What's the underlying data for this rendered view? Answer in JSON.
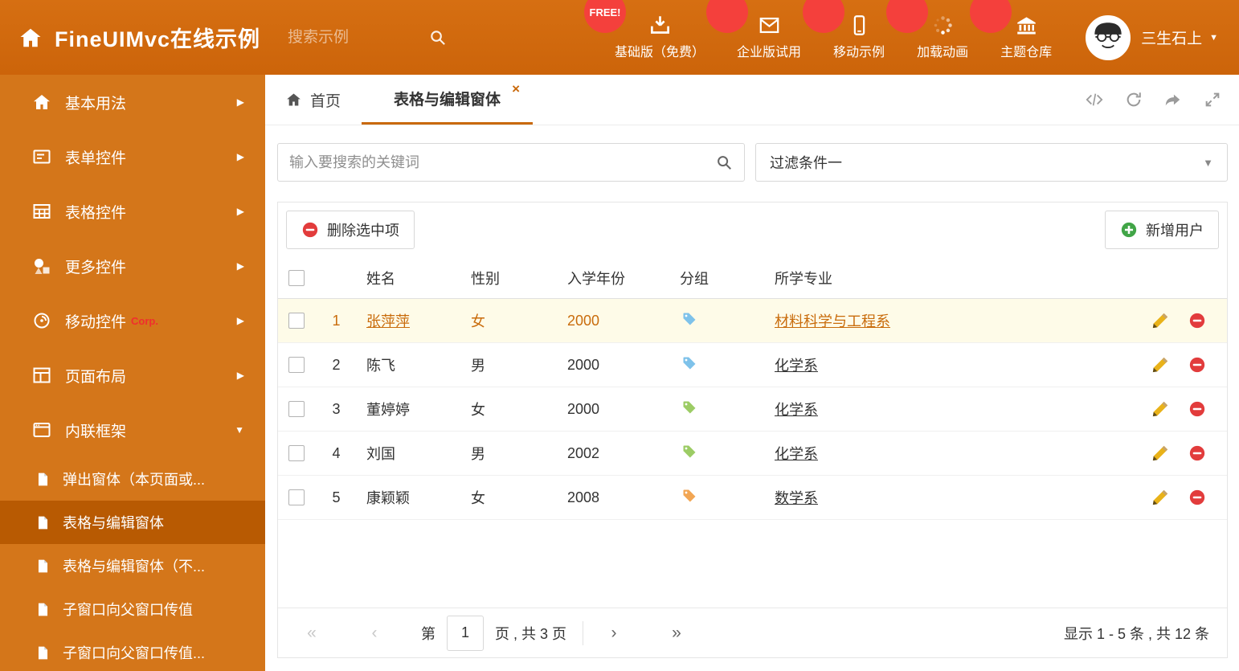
{
  "colors": {
    "accent": "#c9690b",
    "header_bg": "#cc640a",
    "sidebar_bg": "#d4761a",
    "sidebar_active_bg": "#b85a02",
    "selected_row_bg": "#fefbe8",
    "tag_blue": "#7ec2ea",
    "tag_green": "#9ccc65",
    "tag_orange": "#f2a654"
  },
  "icons": {
    "close": "×",
    "caret_down": "▼",
    "arrow_right": "▶",
    "arrow_down": "▼"
  },
  "header": {
    "title": "FineUIMvc在线示例",
    "search_placeholder": "搜索示例",
    "nav": [
      {
        "label": "基础版（免费）",
        "icon": "download-icon",
        "badge": "FREE!"
      },
      {
        "label": "企业版试用",
        "icon": "envelope-icon"
      },
      {
        "label": "移动示例",
        "icon": "mobile-icon"
      },
      {
        "label": "加载动画",
        "icon": "spinner-icon"
      },
      {
        "label": "主题仓库",
        "icon": "bank-icon"
      }
    ],
    "username": "三生石上"
  },
  "sidebar": {
    "items": [
      {
        "label": "基本用法",
        "icon": "home-icon",
        "state": "collapsed"
      },
      {
        "label": "表单控件",
        "icon": "form-icon",
        "state": "collapsed"
      },
      {
        "label": "表格控件",
        "icon": "table-icon",
        "state": "collapsed"
      },
      {
        "label": "更多控件",
        "icon": "controls-icon",
        "state": "collapsed"
      },
      {
        "label": "移动控件",
        "icon": "mobile-nav-icon",
        "badge": "Corp.",
        "state": "collapsed"
      },
      {
        "label": "页面布局",
        "icon": "layout-icon",
        "state": "collapsed"
      },
      {
        "label": "内联框架",
        "icon": "frame-icon",
        "state": "expanded"
      }
    ],
    "subitems": [
      {
        "label": "弹出窗体（本页面或...",
        "active": false
      },
      {
        "label": "表格与编辑窗体",
        "active": true
      },
      {
        "label": "表格与编辑窗体（不...",
        "active": false
      },
      {
        "label": "子窗口向父窗口传值",
        "active": false
      },
      {
        "label": "子窗口向父窗口传值...",
        "active": false
      }
    ]
  },
  "tabs": {
    "items": [
      {
        "label": "首页",
        "active": false
      },
      {
        "label": "表格与编辑窗体",
        "active": true
      }
    ]
  },
  "filter": {
    "keyword_placeholder": "输入要搜索的关键词",
    "condition_value": "过滤条件一"
  },
  "toolbar": {
    "delete_selected": "删除选中项",
    "add_user": "新增用户"
  },
  "table": {
    "columns": [
      "姓名",
      "性别",
      "入学年份",
      "分组",
      "所学专业"
    ],
    "rows": [
      {
        "index": "1",
        "name": "张萍萍",
        "gender": "女",
        "year": "2000",
        "tag": "blue",
        "major": "材料科学与工程系",
        "selected": true
      },
      {
        "index": "2",
        "name": "陈飞",
        "gender": "男",
        "year": "2000",
        "tag": "blue",
        "major": "化学系",
        "selected": false
      },
      {
        "index": "3",
        "name": "董婷婷",
        "gender": "女",
        "year": "2000",
        "tag": "green",
        "major": "化学系",
        "selected": false
      },
      {
        "index": "4",
        "name": "刘国",
        "gender": "男",
        "year": "2002",
        "tag": "green",
        "major": "化学系",
        "selected": false
      },
      {
        "index": "5",
        "name": "康颖颖",
        "gender": "女",
        "year": "2008",
        "tag": "orange",
        "major": "数学系",
        "selected": false
      }
    ]
  },
  "pagination": {
    "first": "«",
    "prev": "‹",
    "page_label_before": "第",
    "page_value": "1",
    "page_label_after": "页 , 共 3 页",
    "next": "›",
    "last": "»",
    "summary": "显示 1 - 5 条 , 共 12 条"
  }
}
